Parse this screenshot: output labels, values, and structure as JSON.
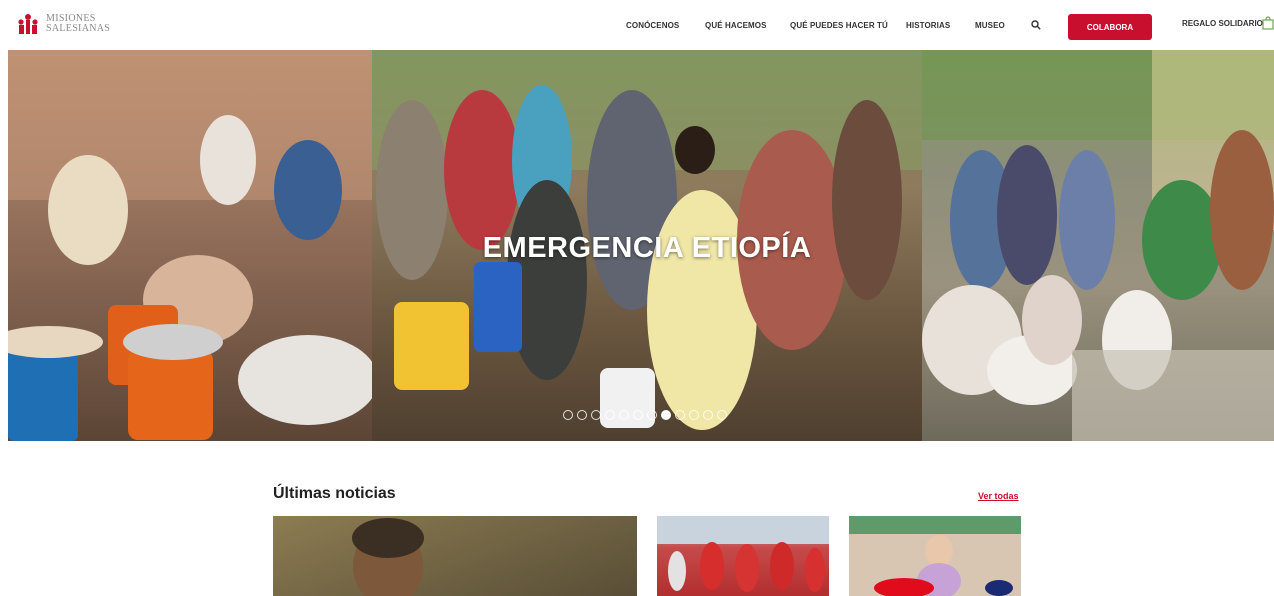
{
  "header": {
    "logo": {
      "line1": "MISIONES",
      "line2": "SALESIANAS"
    },
    "nav": [
      {
        "label": "CONÓCENOS",
        "name": "nav-conocenos"
      },
      {
        "label": "QUÉ HACEMOS",
        "name": "nav-que-hacemos"
      },
      {
        "label": "QUÉ PUEDES HACER TÚ",
        "name": "nav-que-puedes-hacer-tu"
      },
      {
        "label": "HISTORIAS",
        "name": "nav-historias"
      },
      {
        "label": "MUSEO",
        "name": "nav-museo"
      }
    ],
    "cta_label": "COLABORA",
    "gift_label": "REGALO SOLIDARIO"
  },
  "hero": {
    "title": "EMERGENCIA ETIOPÍA",
    "slide_count": 12,
    "active_slide": 7
  },
  "news": {
    "title": "Últimas noticias",
    "see_all": "Ver todas"
  },
  "colors": {
    "brand": "#c8102e",
    "text": "#222222"
  }
}
